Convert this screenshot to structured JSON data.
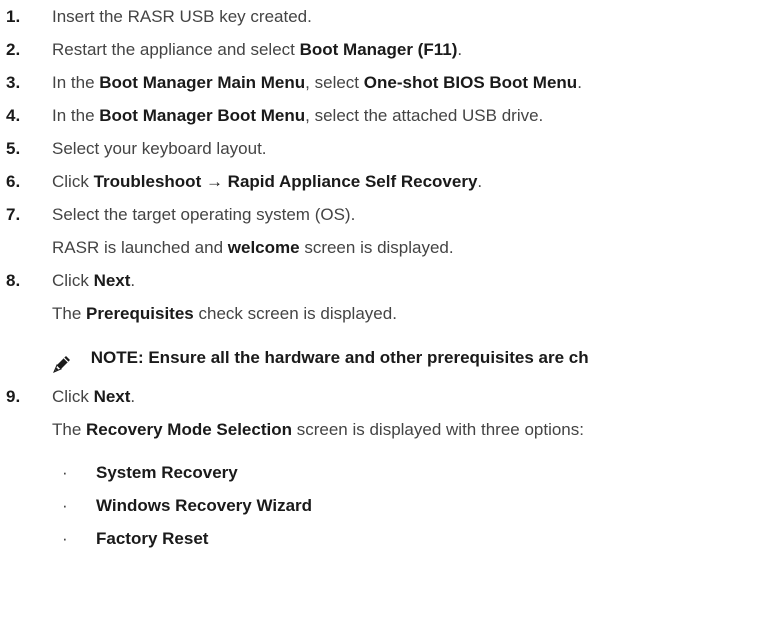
{
  "steps": [
    {
      "num": "1.",
      "parts": [
        {
          "t": "Insert the RASR USB key created.",
          "b": false
        }
      ]
    },
    {
      "num": "2.",
      "parts": [
        {
          "t": "Restart the appliance and select ",
          "b": false
        },
        {
          "t": "Boot Manager (F11)",
          "b": true
        },
        {
          "t": ".",
          "b": false
        }
      ]
    },
    {
      "num": "3.",
      "parts": [
        {
          "t": "In the ",
          "b": false
        },
        {
          "t": "Boot Manager Main Menu",
          "b": true
        },
        {
          "t": ", select ",
          "b": false
        },
        {
          "t": "One-shot BIOS Boot Menu",
          "b": true
        },
        {
          "t": ".",
          "b": false
        }
      ]
    },
    {
      "num": "4.",
      "parts": [
        {
          "t": "In the ",
          "b": false
        },
        {
          "t": "Boot Manager Boot Menu",
          "b": true
        },
        {
          "t": ", select the attached USB drive.",
          "b": false
        }
      ]
    },
    {
      "num": "5.",
      "parts": [
        {
          "t": "Select your keyboard layout.",
          "b": false
        }
      ]
    },
    {
      "num": "6.",
      "parts": [
        {
          "t": "Click ",
          "b": false
        },
        {
          "t": "Troubleshoot → Rapid Appliance Self Recovery",
          "b": true
        },
        {
          "t": ".",
          "b": false
        }
      ]
    },
    {
      "num": "7.",
      "parts": [
        {
          "t": "Select the target operating system (OS).",
          "b": false
        }
      ],
      "sub": [
        {
          "t": "RASR is launched and ",
          "b": false
        },
        {
          "t": "welcome",
          "b": true
        },
        {
          "t": " screen is displayed.",
          "b": false
        }
      ]
    },
    {
      "num": "8.",
      "parts": [
        {
          "t": "Click ",
          "b": false
        },
        {
          "t": "Next",
          "b": true
        },
        {
          "t": ".",
          "b": false
        }
      ],
      "sub": [
        {
          "t": "The ",
          "b": false
        },
        {
          "t": "Prerequisites",
          "b": true
        },
        {
          "t": " check screen is displayed.",
          "b": false
        }
      ]
    }
  ],
  "note": {
    "icon": "note-pencil-icon",
    "text": "NOTE: Ensure all the hardware and other prerequisites are ch"
  },
  "step9": {
    "num": "9.",
    "parts": [
      {
        "t": "Click ",
        "b": false
      },
      {
        "t": "Next",
        "b": true
      },
      {
        "t": ".",
        "b": false
      }
    ],
    "sub": [
      {
        "t": "The ",
        "b": false
      },
      {
        "t": "Recovery Mode Selection",
        "b": true
      },
      {
        "t": " screen is displayed with three options:",
        "b": false
      }
    ]
  },
  "options": [
    {
      "bullet": "·",
      "label": "System Recovery"
    },
    {
      "bullet": "·",
      "label": "Windows Recovery Wizard"
    },
    {
      "bullet": "·",
      "label": "Factory Reset"
    }
  ]
}
